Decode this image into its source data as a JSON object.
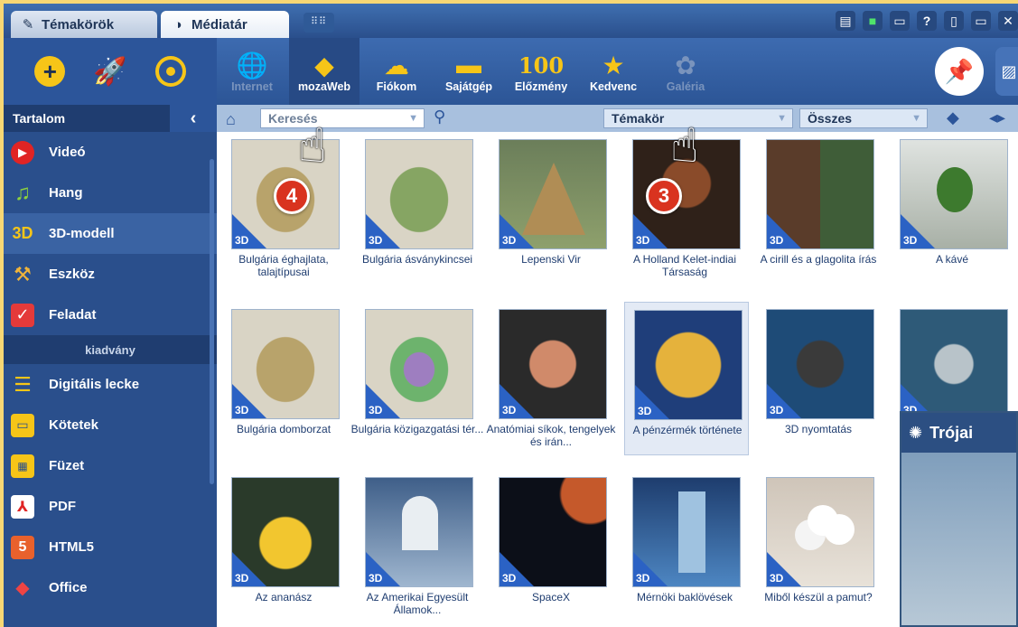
{
  "tabs": [
    {
      "label": "Témakörök",
      "active": false
    },
    {
      "label": "Médiatár",
      "active": true
    }
  ],
  "quickbar_icons": [
    "plus-icon",
    "rocket-icon",
    "target-icon"
  ],
  "toolbar": [
    {
      "label": "Internet",
      "icon": "globe-icon",
      "dim": true
    },
    {
      "label": "mozaWeb",
      "icon": "diamond-icon",
      "selected": true
    },
    {
      "label": "Fiókom",
      "icon": "cloud-lock-icon"
    },
    {
      "label": "Sajátgép",
      "icon": "monitor-icon"
    },
    {
      "label": "Előzmény",
      "icon": "history-icon",
      "glyph": "100"
    },
    {
      "label": "Kedvenc",
      "icon": "star-icon"
    },
    {
      "label": "Galéria",
      "icon": "gallery-icon",
      "dim": true
    }
  ],
  "sidebar": {
    "header": "Tartalom",
    "items": [
      {
        "label": "Videó",
        "icon": "video-icon"
      },
      {
        "label": "Hang",
        "icon": "music-icon"
      },
      {
        "label": "3D-modell",
        "icon": "3d-icon",
        "selected": true
      },
      {
        "label": "Eszköz",
        "icon": "tool-icon"
      },
      {
        "label": "Feladat",
        "icon": "task-icon"
      }
    ],
    "subheader": "kiadvány",
    "items2": [
      {
        "label": "Digitális lecke",
        "icon": "lesson-icon"
      },
      {
        "label": "Kötetek",
        "icon": "book-icon"
      },
      {
        "label": "Füzet",
        "icon": "notebook-icon"
      },
      {
        "label": "PDF",
        "icon": "pdf-icon"
      },
      {
        "label": "HTML5",
        "icon": "html5-icon"
      },
      {
        "label": "Office",
        "icon": "office-icon"
      }
    ]
  },
  "search": {
    "placeholder": "Keresés",
    "topic": "Témakör",
    "all": "Összes"
  },
  "cards": [
    {
      "caption": "Bulgária éghajlata, talajtípusai",
      "art": "t-map"
    },
    {
      "caption": "Bulgária ásványkincsei",
      "art": "t-map2"
    },
    {
      "caption": "Lepenski Vir",
      "art": "t-hut"
    },
    {
      "caption": "A Holland Kelet-indiai Társaság",
      "art": "t-man"
    },
    {
      "caption": "A cirill és a glagolita írás",
      "art": "t-monks"
    },
    {
      "caption": "A kávé",
      "art": "t-plant"
    },
    {
      "caption": "Bulgária domborzat",
      "art": "t-map"
    },
    {
      "caption": "Bulgária közigazgatási tér...",
      "art": "t-map3"
    },
    {
      "caption": "Anatómiai síkok, tengelyek és irán...",
      "art": "t-body"
    },
    {
      "caption": "A pénzérmék története",
      "art": "t-coin",
      "selected": true
    },
    {
      "caption": "3D nyomtatás",
      "art": "t-printer"
    },
    {
      "caption": "",
      "art": "t-squid"
    },
    {
      "caption": "Az ananász",
      "art": "t-pine"
    },
    {
      "caption": "Az Amerikai Egyesült Államok...",
      "art": "t-capitol"
    },
    {
      "caption": "SpaceX",
      "art": "t-space"
    },
    {
      "caption": "Mérnöki baklövések",
      "art": "t-building"
    },
    {
      "caption": "Miből készül a pamut?",
      "art": "t-cotton"
    }
  ],
  "badge_3d": "3D",
  "annotations": [
    {
      "number": "4"
    },
    {
      "number": "3"
    }
  ],
  "popup": {
    "title": "Trójai"
  }
}
